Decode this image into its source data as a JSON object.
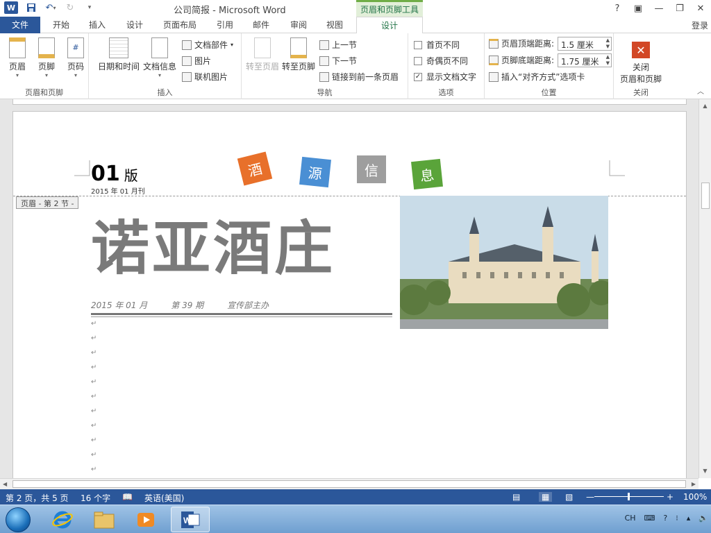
{
  "window": {
    "title": "公司简报 - Microsoft Word",
    "context_tool": "页眉和页脚工具",
    "controls": [
      "?",
      "❐",
      "—",
      "❐",
      "✕"
    ]
  },
  "tabs": [
    {
      "label": "文件"
    },
    {
      "label": "开始"
    },
    {
      "label": "插入"
    },
    {
      "label": "设计"
    },
    {
      "label": "页面布局"
    },
    {
      "label": "引用"
    },
    {
      "label": "邮件"
    },
    {
      "label": "审阅"
    },
    {
      "label": "视图"
    },
    {
      "label": "设计"
    }
  ],
  "login": "登录",
  "ribbon": {
    "header_footer_group": {
      "label": "页眉和页脚",
      "header": "页眉",
      "footer": "页脚",
      "page_number": "页码"
    },
    "insert_group": {
      "label": "插入",
      "datetime": "日期和时间",
      "docinfo": "文档信息",
      "quickparts": "文档部件",
      "picture": "图片",
      "online_picture": "联机图片"
    },
    "nav_group": {
      "label": "导航",
      "goto_header": "转至页眉",
      "goto_footer": "转至页脚",
      "prev": "上一节",
      "next": "下一节",
      "link_prev": "链接到前一条页眉"
    },
    "options_group": {
      "label": "选项",
      "diff_first": "首页不同",
      "diff_odd_even": "奇偶页不同",
      "show_text": "显示文档文字",
      "show_text_checked": true
    },
    "position_group": {
      "label": "位置",
      "header_top_label": "页眉顶端距离:",
      "header_top_value": "1.5 厘米",
      "footer_bottom_label": "页脚底端距离:",
      "footer_bottom_value": "1.75 厘米",
      "insert_align_tab": "插入“对齐方式”选项卡"
    },
    "close_group": {
      "label": "关闭",
      "close_line1": "关闭",
      "close_line2": "页眉和页脚"
    }
  },
  "document": {
    "issue_number": "01",
    "issue_suffix": "版",
    "issue_date": "2015 年 01 月刊",
    "tiles": [
      {
        "char": "酒",
        "color": "#e8702a"
      },
      {
        "char": "源",
        "color": "#4a8fd4"
      },
      {
        "char": "信",
        "color": "#9e9e9e"
      },
      {
        "char": "息",
        "color": "#5aa43a"
      }
    ],
    "header_label": "页眉 - 第 2 节 -",
    "title": "诺亚酒庄",
    "subline": {
      "date": "2015 年 01 月",
      "issue": "第 39 期",
      "dept": "宣传部主办"
    },
    "paragraph_mark": "↵"
  },
  "statusbar": {
    "page": "第 2 页，共 5 页",
    "words": "16 个字",
    "language": "英语(美国)",
    "zoom": "100%",
    "zoom_level_percent": 100
  },
  "taskbar": {
    "tray_lang": "CH"
  },
  "colors": {
    "word_blue": "#2b579a",
    "context_green": "#217346",
    "close_red": "#d24726"
  }
}
